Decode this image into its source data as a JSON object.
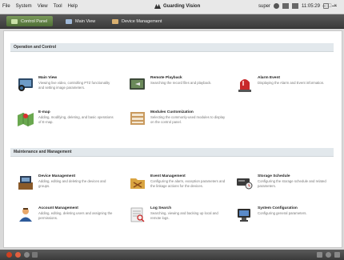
{
  "menubar": {
    "menus": [
      "File",
      "System",
      "View",
      "Tool",
      "Help"
    ],
    "app_title": "Guarding Vision",
    "user": "super",
    "time": "11:05:29"
  },
  "tabs": [
    {
      "label": "Control Panel",
      "active": true
    },
    {
      "label": "Main View",
      "active": false
    },
    {
      "label": "Device Management",
      "active": false
    }
  ],
  "sections": [
    {
      "title": "Operation and Control",
      "items": [
        {
          "title": "Main View",
          "desc": "Viewing live video, controlling PTZ functionality and setting image parameters.",
          "icon": "main-view-icon"
        },
        {
          "title": "Remote Playback",
          "desc": "Searching the record files and playback.",
          "icon": "remote-playback-icon"
        },
        {
          "title": "Alarm Event",
          "desc": "Displaying the Alarm and Event information.",
          "icon": "alarm-event-icon"
        },
        {
          "title": "E-map",
          "desc": "Adding, modifying, deleting, and basic operations of E-map.",
          "icon": "emap-icon"
        },
        {
          "title": "Modules Customization",
          "desc": "Selecting the commonly-used modules to display on the control panel.",
          "icon": "modules-customization-icon"
        }
      ]
    },
    {
      "title": "Maintenance and Management",
      "items": [
        {
          "title": "Device Management",
          "desc": "Adding, editing and deleting the devices and groups.",
          "icon": "device-management-icon"
        },
        {
          "title": "Event Management",
          "desc": "Configuring the alarm, exception parameters and the linkage actions for the devices.",
          "icon": "event-management-icon"
        },
        {
          "title": "Storage Schedule",
          "desc": "Configuring the storage schedule and related parameters.",
          "icon": "storage-schedule-icon"
        },
        {
          "title": "Account Management",
          "desc": "Adding, editing, deleting users and assigning the permissions.",
          "icon": "account-management-icon"
        },
        {
          "title": "Log Search",
          "desc": "Searching, viewing and backing up local and remote logs.",
          "icon": "log-search-icon"
        },
        {
          "title": "System Configuration",
          "desc": "Configuring general parameters.",
          "icon": "system-configuration-icon"
        }
      ]
    }
  ],
  "colors": {
    "active_tab": "#5e8040",
    "section_header": "#e2e8ec",
    "bars": "#4a4a4a"
  }
}
